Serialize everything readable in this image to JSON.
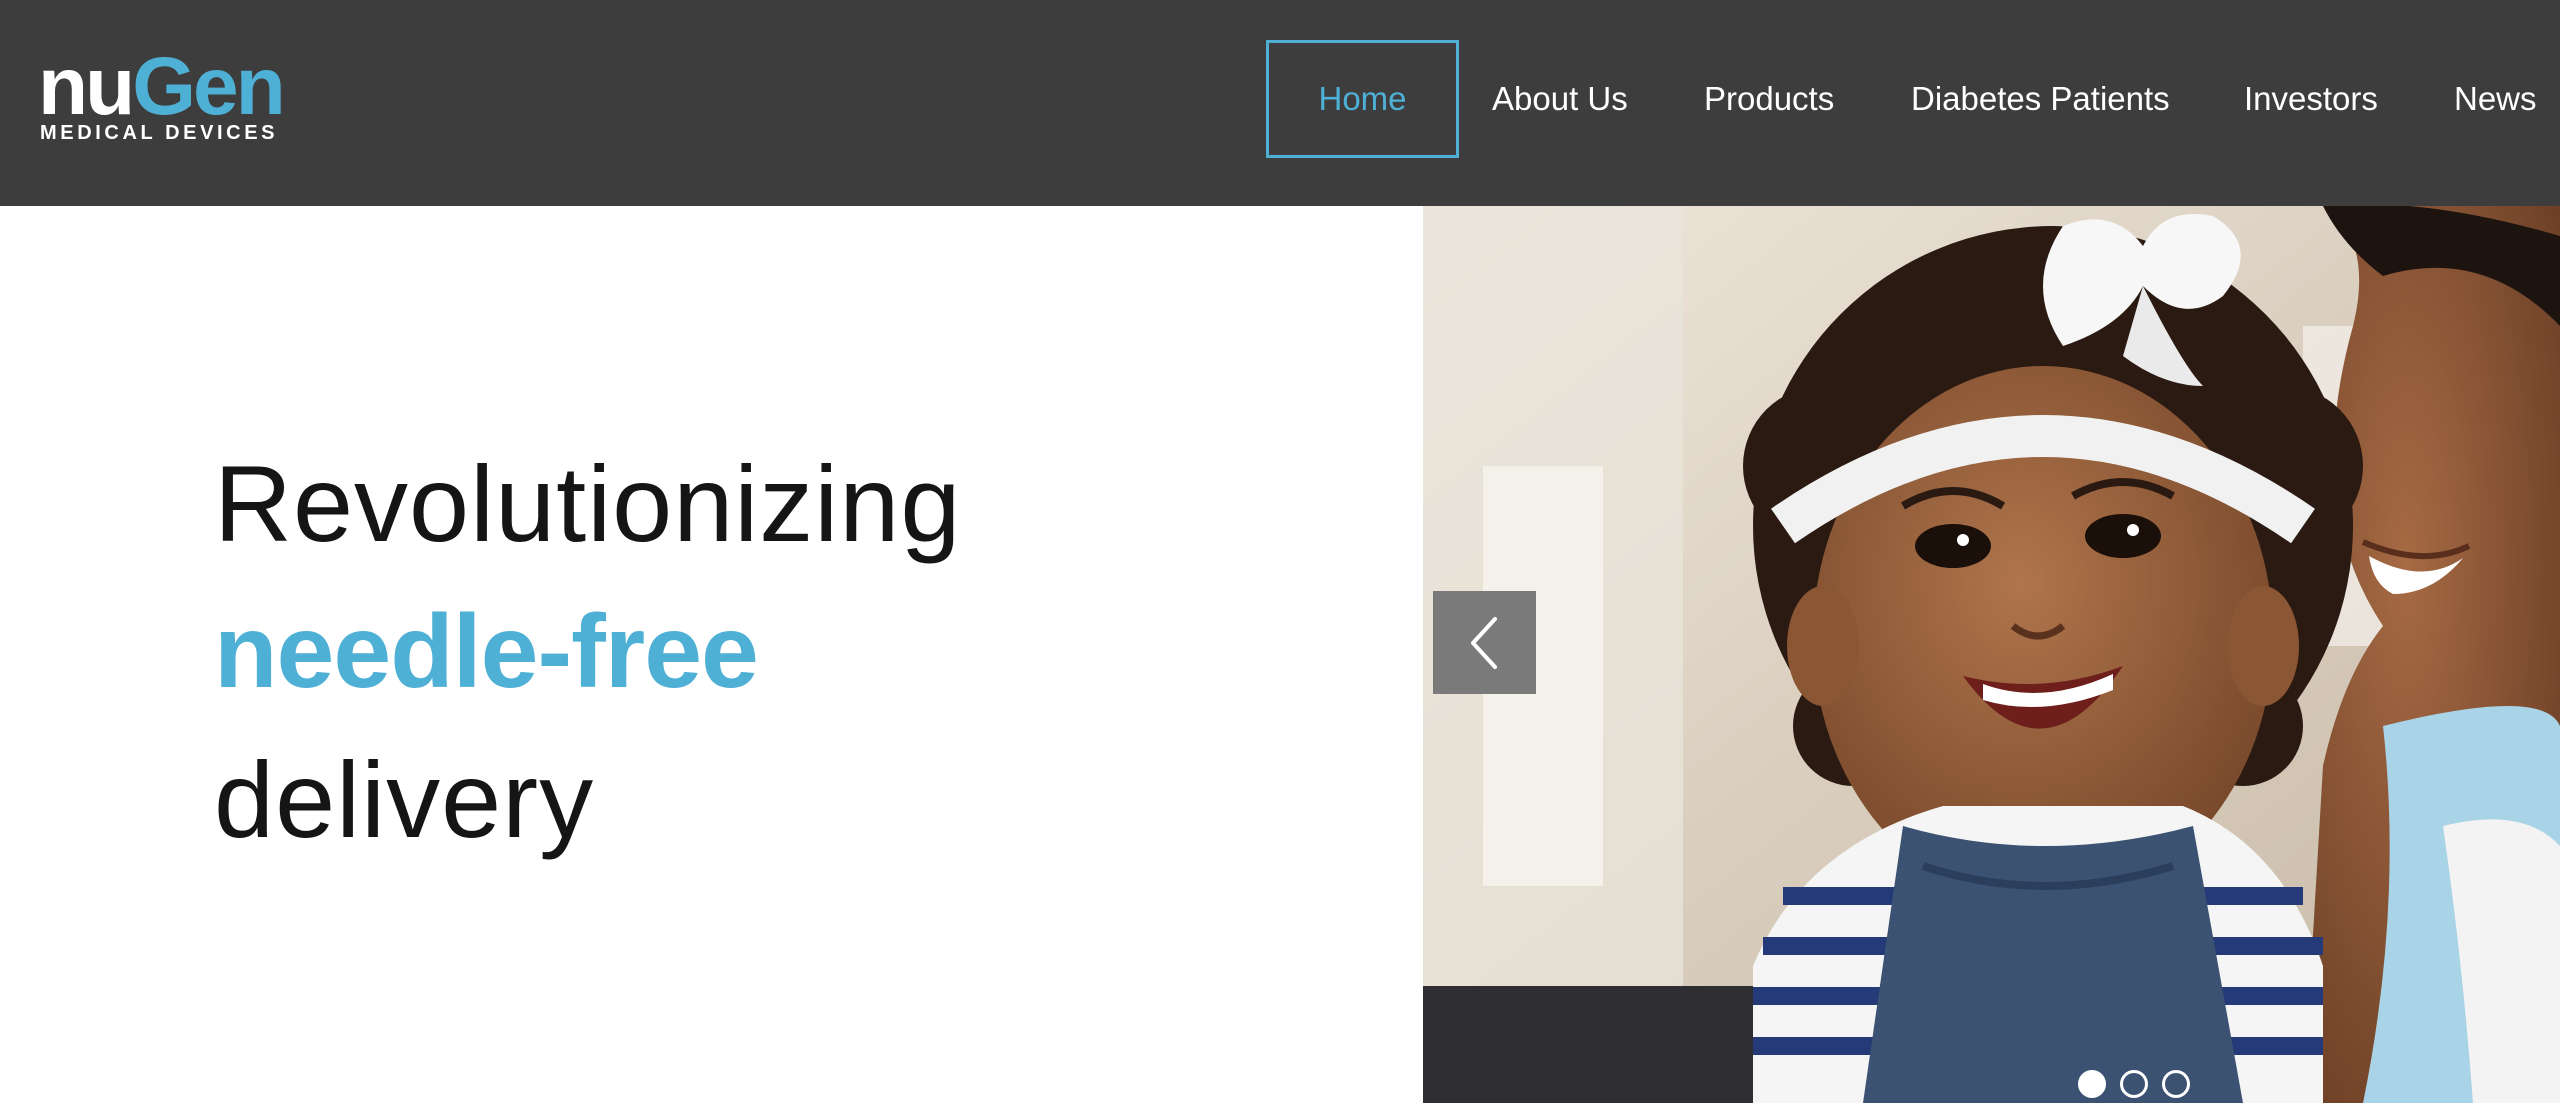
{
  "brand": {
    "name_part1": "nu",
    "name_part2": "Gen",
    "tagline": "MEDICAL DEVICES",
    "accent_color": "#4fb0d6",
    "header_background": "#3d3d3d"
  },
  "nav": {
    "items": [
      {
        "label": "Home",
        "active": true
      },
      {
        "label": "About Us",
        "active": false
      },
      {
        "label": "Products",
        "active": false
      },
      {
        "label": "Diabetes Patients",
        "active": false
      },
      {
        "label": "Investors",
        "active": false
      },
      {
        "label": "News",
        "active": false
      }
    ]
  },
  "hero": {
    "line1": "Revolutionizing",
    "line2": "needle-free",
    "line3": "delivery",
    "image_subject": "smiling toddler with white headband held by smiling woman"
  },
  "carousel": {
    "prev_icon": "chevron-left-icon",
    "slide_count": 3,
    "active_slide": 1
  }
}
